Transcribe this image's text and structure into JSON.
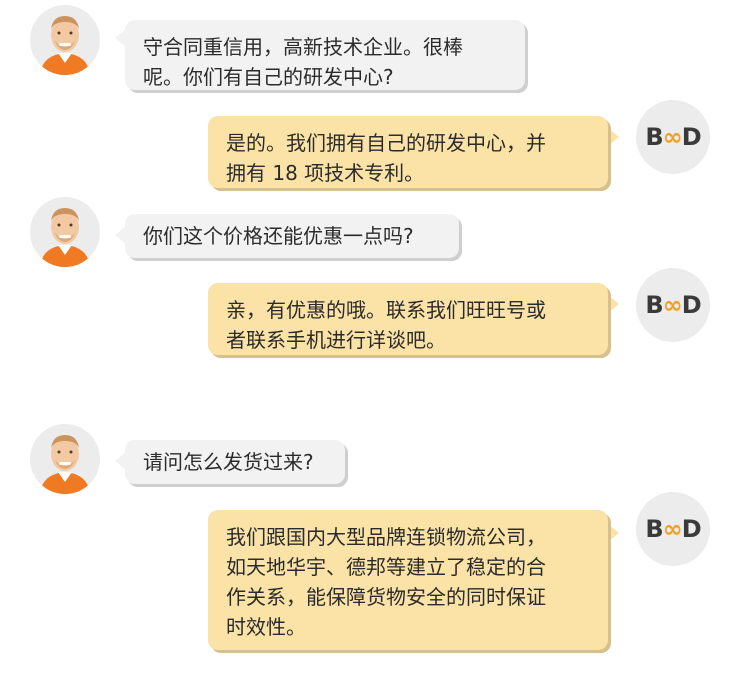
{
  "colors": {
    "user_bubble": "#f2f2f2",
    "shop_bubble": "#fbe3a7",
    "avatar_shirt": "#f07a22",
    "logo_accent": "#f0a024"
  },
  "shop_logo": {
    "left": "B",
    "mid": "∞",
    "right": "D"
  },
  "messages": [
    {
      "sender": "customer",
      "avatar_icon": "customer-avatar-icon",
      "text": "守合同重信用，高新技术企业。很棒\n呢。你们有自己的研发中心?"
    },
    {
      "sender": "shop",
      "avatar_icon": "shop-logo-icon",
      "text": "是的。我们拥有自己的研发中心，并\n拥有 18 项技术专利。"
    },
    {
      "sender": "customer",
      "avatar_icon": "customer-avatar-icon",
      "text": "你们这个价格还能优惠一点吗?"
    },
    {
      "sender": "shop",
      "avatar_icon": "shop-logo-icon",
      "text": "亲，有优惠的哦。联系我们旺旺号或\n者联系手机进行详谈吧。"
    },
    {
      "sender": "customer",
      "avatar_icon": "customer-avatar-icon",
      "text": "请问怎么发货过来?"
    },
    {
      "sender": "shop",
      "avatar_icon": "shop-logo-icon",
      "text": "我们跟国内大型品牌连锁物流公司，\n如天地华宇、德邦等建立了稳定的合\n作关系，能保障货物安全的同时保证\n时效性。"
    }
  ]
}
